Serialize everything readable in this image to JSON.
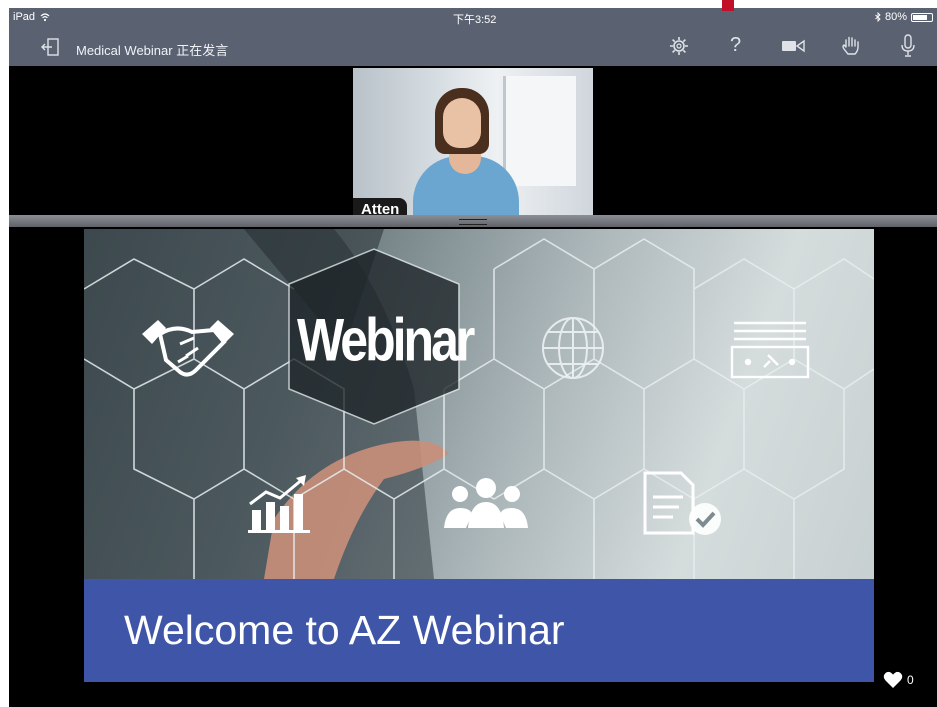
{
  "status_bar": {
    "device": "iPad",
    "time": "下午3:52",
    "battery": "80%",
    "battery_level": 0.8,
    "background": "#5a6272"
  },
  "toolbar": {
    "title": "Medical Webinar 正在发言",
    "background": "#5a6272",
    "icons": [
      "exit-icon",
      "settings-icon",
      "help-icon",
      "camera-icon",
      "raise-hand-icon",
      "microphone-icon"
    ],
    "help_label": "?"
  },
  "video": {
    "participant_name": "Atten"
  },
  "slide": {
    "hexagon_label": "Webinar",
    "banner_text": "Welcome to AZ Webinar",
    "banner_color": "#3f56a8",
    "icons": [
      "handshake-icon",
      "globe-icon",
      "certificate-icon",
      "chart-icon",
      "people-icon",
      "document-check-icon"
    ]
  },
  "likes": {
    "count": "0"
  },
  "colors": {
    "marker": "#c0102a",
    "background": "#000000"
  }
}
